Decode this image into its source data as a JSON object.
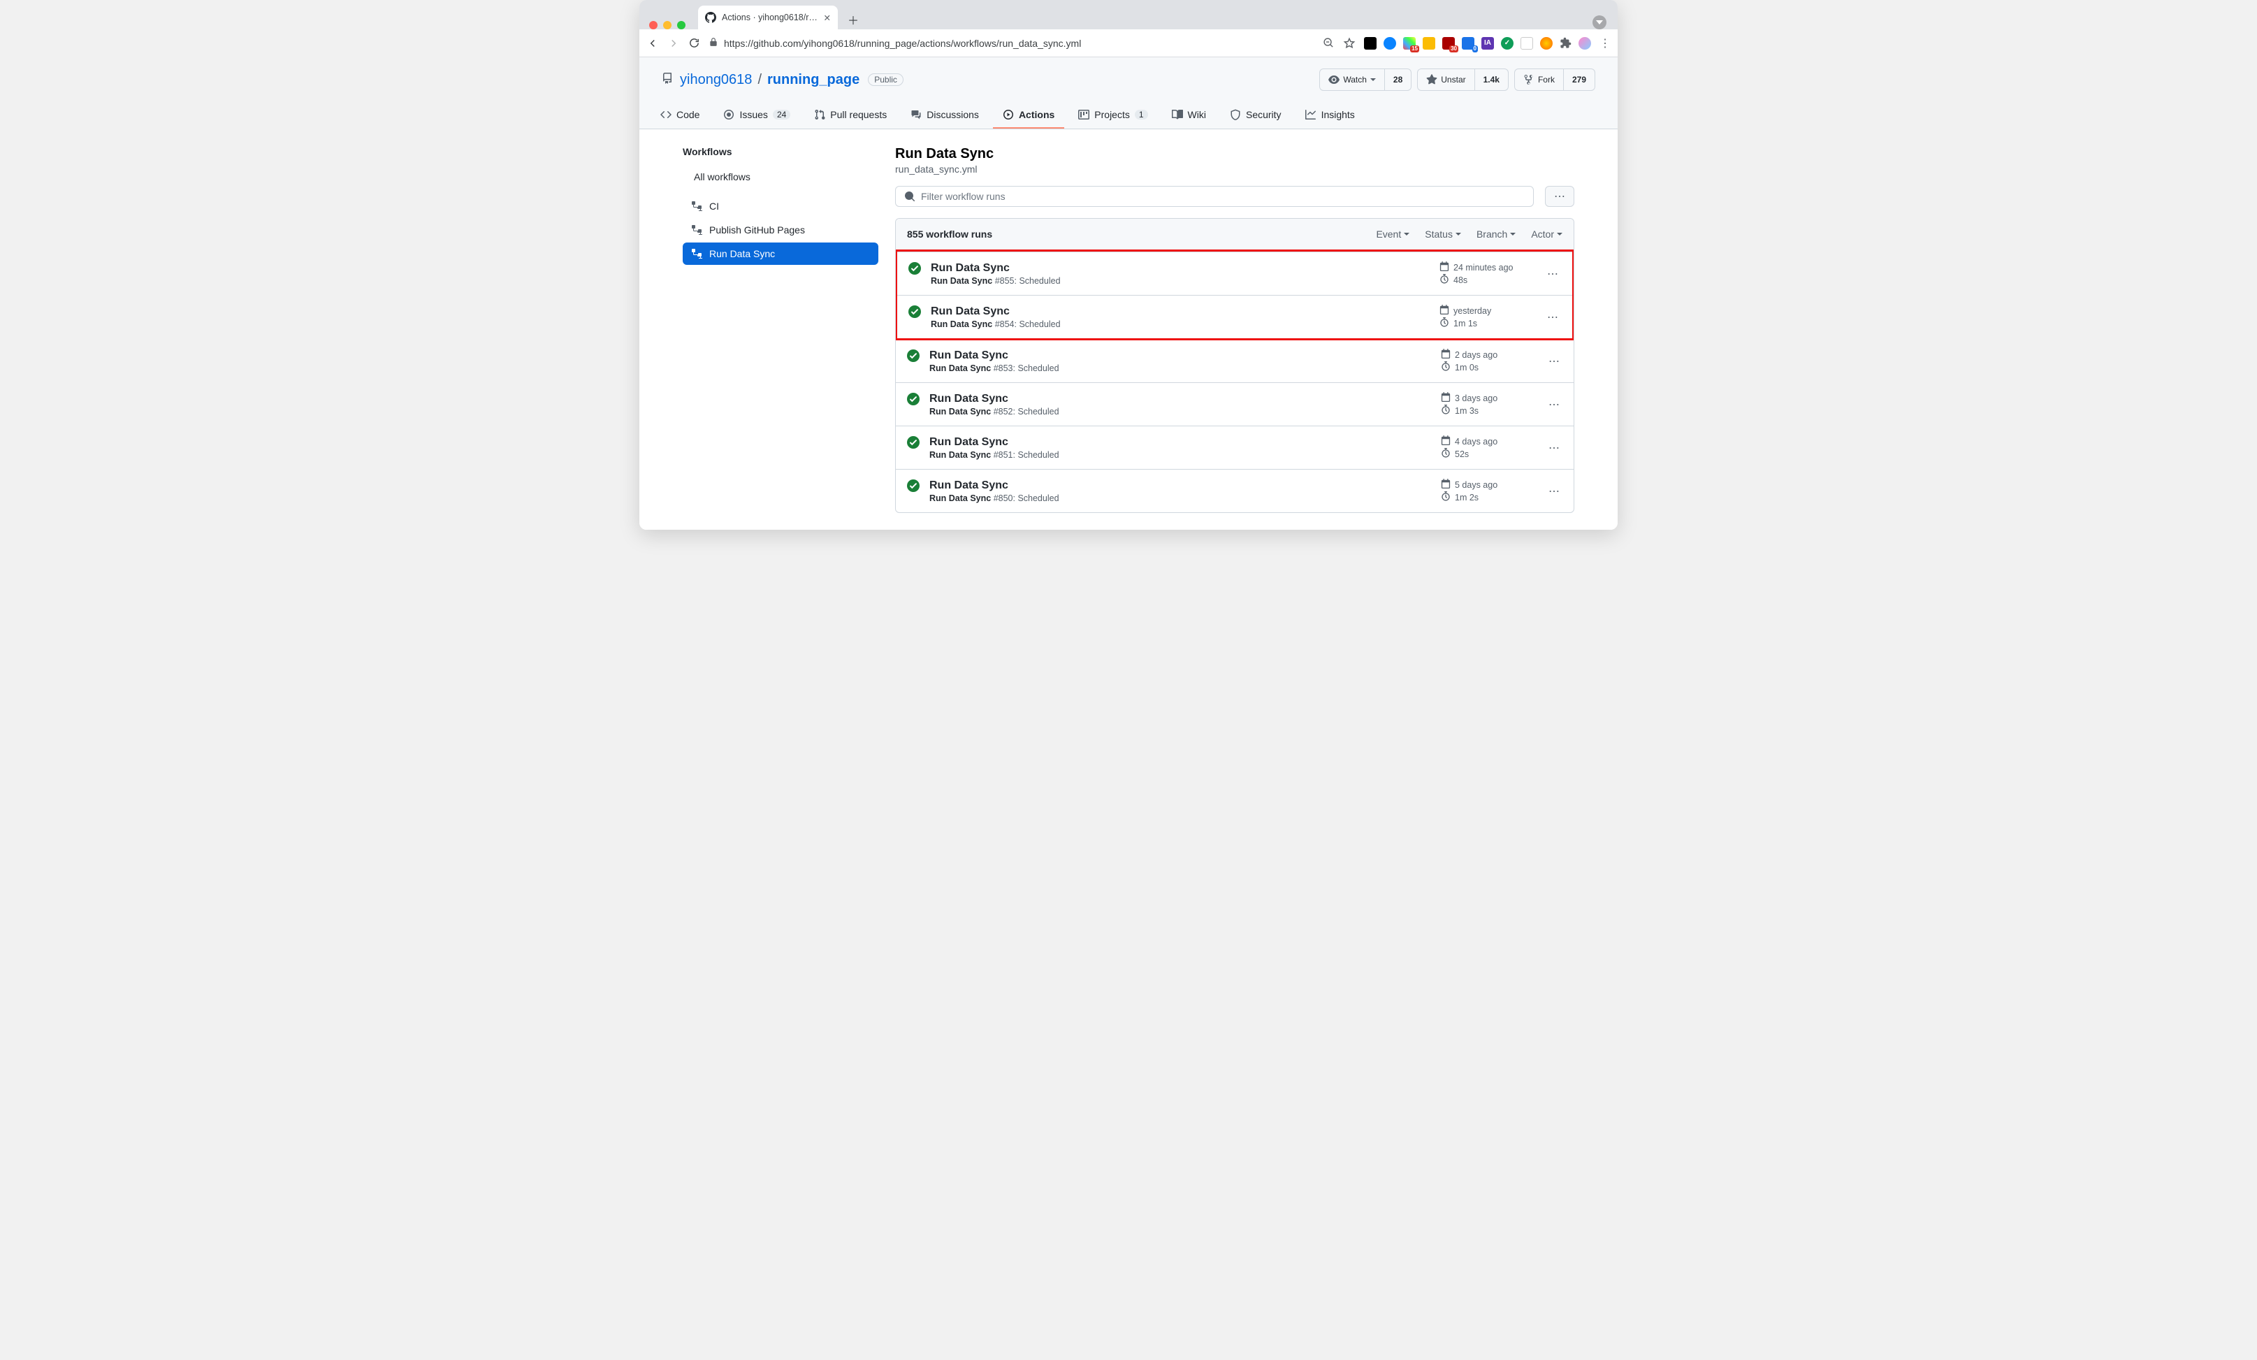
{
  "browser": {
    "tab_title": "Actions · yihong0618/running…",
    "url": "https://github.com/yihong0618/running_page/actions/workflows/run_data_sync.yml"
  },
  "repo": {
    "owner": "yihong0618",
    "name": "running_page",
    "visibility": "Public"
  },
  "header_actions": {
    "watch_label": "Watch",
    "watch_count": "28",
    "unstar_label": "Unstar",
    "star_count": "1.4k",
    "fork_label": "Fork",
    "fork_count": "279"
  },
  "reponav": {
    "code": "Code",
    "issues": "Issues",
    "issues_count": "24",
    "pulls": "Pull requests",
    "discussions": "Discussions",
    "actions": "Actions",
    "projects": "Projects",
    "projects_count": "1",
    "wiki": "Wiki",
    "security": "Security",
    "insights": "Insights"
  },
  "sidebar": {
    "heading": "Workflows",
    "all": "All workflows",
    "items": [
      {
        "label": "CI"
      },
      {
        "label": "Publish GitHub Pages"
      },
      {
        "label": "Run Data Sync"
      }
    ]
  },
  "page": {
    "title": "Run Data Sync",
    "file": "run_data_sync.yml",
    "filter_placeholder": "Filter workflow runs",
    "count_text": "855 workflow runs",
    "filters": {
      "event": "Event",
      "status": "Status",
      "branch": "Branch",
      "actor": "Actor"
    }
  },
  "runs": [
    {
      "title": "Run Data Sync",
      "wf": "Run Data Sync",
      "num": "#855",
      "trigger": "Scheduled",
      "time": "24 minutes ago",
      "dur": "48s",
      "highlight": true
    },
    {
      "title": "Run Data Sync",
      "wf": "Run Data Sync",
      "num": "#854",
      "trigger": "Scheduled",
      "time": "yesterday",
      "dur": "1m 1s",
      "highlight": true
    },
    {
      "title": "Run Data Sync",
      "wf": "Run Data Sync",
      "num": "#853",
      "trigger": "Scheduled",
      "time": "2 days ago",
      "dur": "1m 0s"
    },
    {
      "title": "Run Data Sync",
      "wf": "Run Data Sync",
      "num": "#852",
      "trigger": "Scheduled",
      "time": "3 days ago",
      "dur": "1m 3s"
    },
    {
      "title": "Run Data Sync",
      "wf": "Run Data Sync",
      "num": "#851",
      "trigger": "Scheduled",
      "time": "4 days ago",
      "dur": "52s"
    },
    {
      "title": "Run Data Sync",
      "wf": "Run Data Sync",
      "num": "#850",
      "trigger": "Scheduled",
      "time": "5 days ago",
      "dur": "1m 2s"
    }
  ]
}
